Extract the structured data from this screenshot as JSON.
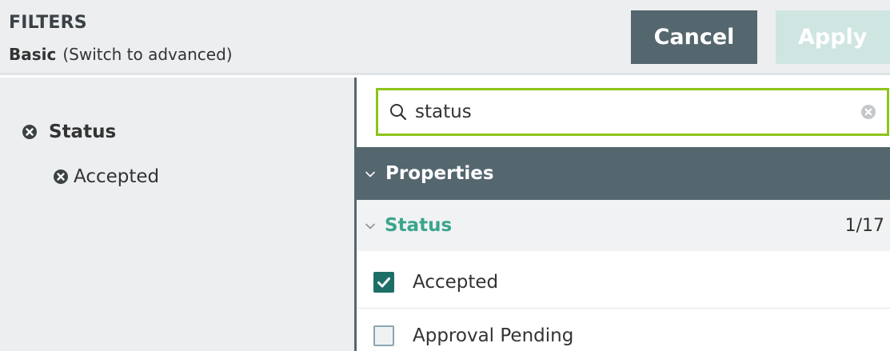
{
  "header": {
    "title": "FILTERS",
    "mode_current": "Basic",
    "mode_switch": "(Switch to advanced)",
    "cancel_label": "Cancel",
    "apply_label": "Apply"
  },
  "selected": {
    "group_label": "Status",
    "items": [
      {
        "label": "Accepted"
      }
    ]
  },
  "search": {
    "value": "status",
    "placeholder": ""
  },
  "properties": {
    "section_label": "Properties",
    "group_label": "Status",
    "count": "1/17",
    "options": [
      {
        "label": "Accepted",
        "checked": true
      },
      {
        "label": "Approval Pending",
        "checked": false
      }
    ]
  },
  "colors": {
    "accent_green": "#8cc41b",
    "slate": "#54666e",
    "teal_text": "#3aa58c",
    "checkbox_checked": "#1e6e68"
  },
  "icons": [
    "close-circle-icon",
    "search-icon",
    "clear-icon",
    "chevron-down-icon",
    "checkmark-icon"
  ]
}
